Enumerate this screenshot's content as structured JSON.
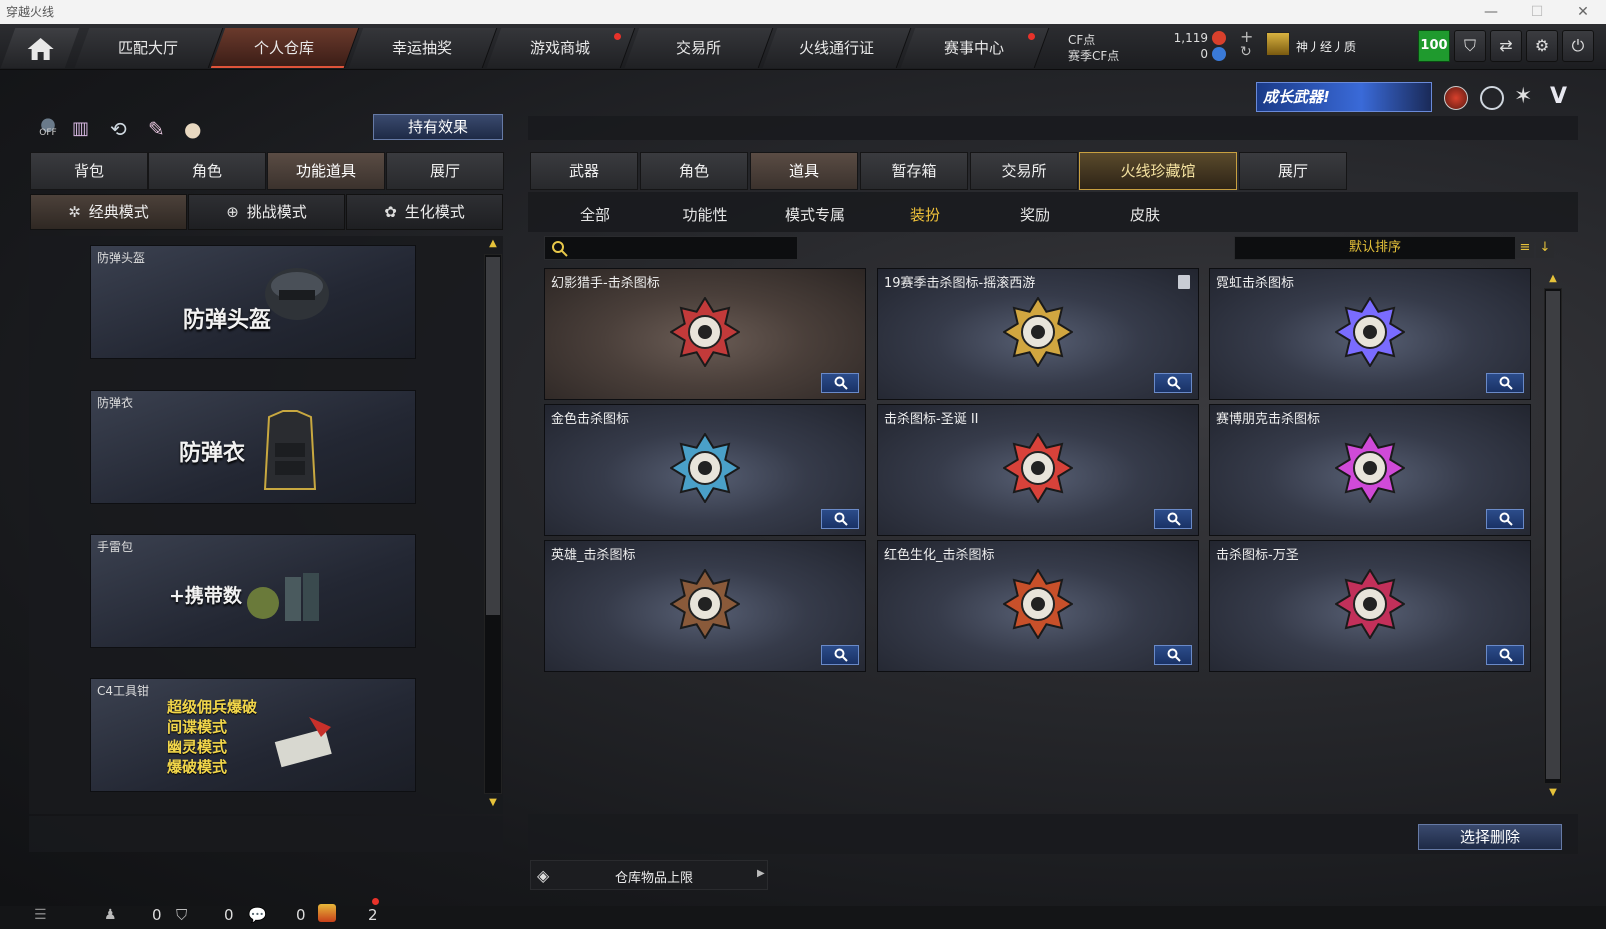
{
  "window": {
    "title": "穿越火线"
  },
  "nav": {
    "tabs": [
      {
        "label": "匹配大厅",
        "dot": false
      },
      {
        "label": "个人仓库",
        "dot": false,
        "active": true
      },
      {
        "label": "幸运抽奖",
        "dot": false
      },
      {
        "label": "游戏商城",
        "dot": true
      },
      {
        "label": "交易所",
        "dot": false
      },
      {
        "label": "火线通行证",
        "dot": false
      },
      {
        "label": "赛事中心",
        "dot": true
      }
    ],
    "cf_label": "CF点",
    "cf_value": "1,119",
    "season_label": "赛季CF点",
    "season_value": "0",
    "username": "神丿经丿质",
    "level": "100"
  },
  "left": {
    "effects_button": "持有效果",
    "tabs": [
      {
        "label": "背包"
      },
      {
        "label": "角色"
      },
      {
        "label": "功能道具",
        "selected": true
      },
      {
        "label": "展厅"
      }
    ],
    "modes": [
      {
        "label": "经典模式",
        "selected": true
      },
      {
        "label": "挑战模式"
      },
      {
        "label": "生化模式"
      }
    ],
    "items": [
      {
        "label": "防弹头盔",
        "big": "防弹头盔"
      },
      {
        "label": "防弹衣",
        "big": "防弹衣"
      },
      {
        "label": "手雷包",
        "big": "+携带数"
      },
      {
        "label": "C4工具钳",
        "lines": [
          "超级佣兵爆破",
          "间谍模式",
          "幽灵模式",
          "爆破模式"
        ]
      }
    ]
  },
  "right": {
    "banner_text": "成长武器!",
    "tabs": [
      {
        "label": "武器"
      },
      {
        "label": "角色"
      },
      {
        "label": "道具",
        "selected": true
      },
      {
        "label": "暂存箱"
      },
      {
        "label": "交易所"
      },
      {
        "label": "火线珍藏馆",
        "highlight": true
      },
      {
        "label": "展厅"
      }
    ],
    "subtabs": [
      {
        "label": "全部"
      },
      {
        "label": "功能性"
      },
      {
        "label": "模式专属"
      },
      {
        "label": "装扮",
        "selected": true
      },
      {
        "label": "奖励"
      },
      {
        "label": "皮肤"
      }
    ],
    "search_placeholder": "",
    "sort_label": "默认排序",
    "cards": [
      {
        "label": "幻影猎手-击杀图标",
        "color": "#c23a3a"
      },
      {
        "label": "19赛季击杀图标-摇滚西游",
        "color": "#d1a640",
        "trash": true
      },
      {
        "label": "霓虹击杀图标",
        "color": "#7a6cff"
      },
      {
        "label": "金色击杀图标",
        "color": "#4aa0c8"
      },
      {
        "label": "击杀图标-圣诞 II",
        "color": "#d8423a"
      },
      {
        "label": "赛博朋克击杀图标",
        "color": "#d04ad8"
      },
      {
        "label": "英雄_击杀图标",
        "color": "#8a5a3a"
      },
      {
        "label": "红色生化_击杀图标",
        "color": "#c8502a"
      },
      {
        "label": "击杀图标-万圣",
        "color": "#c2305a"
      }
    ],
    "delete_button": "选择删除",
    "storage_label": "仓库物品上限"
  },
  "status": {
    "count1": "0",
    "count2": "0",
    "count3": "0",
    "count4": "2"
  }
}
